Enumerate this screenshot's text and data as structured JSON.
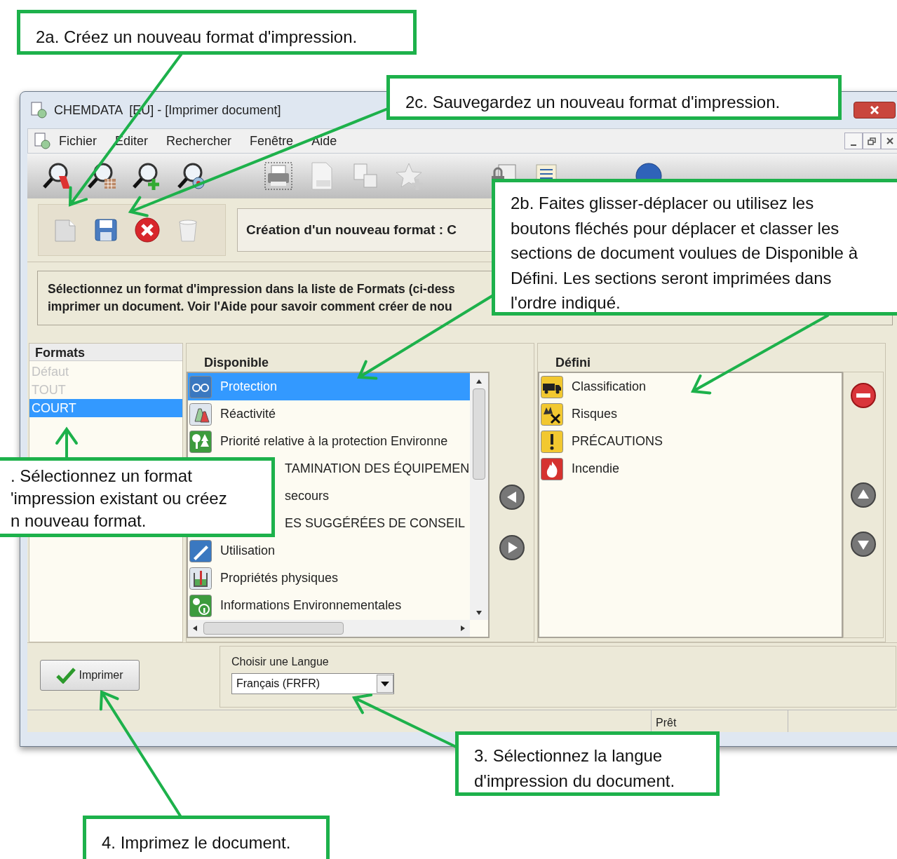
{
  "window": {
    "title": "CHEMDATA  [EU] - [Imprimer document]"
  },
  "menu": [
    "Fichier",
    "Editer",
    "Rechercher",
    "Fenêtre",
    "Aide"
  ],
  "format_heading": "Création d'un nouveau format : C",
  "info_lines": [
    "Sélectionnez un format d'impression dans la liste de Formats (ci-dess",
    "imprimer un document. Voir l'Aide pour savoir comment créer de nou"
  ],
  "formats": {
    "header": "Formats",
    "items": [
      {
        "label": "Défaut",
        "selected": false,
        "disabled": true
      },
      {
        "label": "TOUT",
        "selected": false,
        "disabled": true
      },
      {
        "label": "COURT",
        "selected": true,
        "disabled": false
      }
    ]
  },
  "available": {
    "header": "Disponible",
    "items": [
      {
        "label": "Protection",
        "kind": "glasses",
        "selected": true
      },
      {
        "label": "Réactivité",
        "kind": "flask",
        "selected": false
      },
      {
        "label": "Priorité relative à la protection Environne",
        "kind": "trees",
        "selected": false
      },
      {
        "label": "TAMINATION DES ÉQUIPEMEN",
        "selected": false
      },
      {
        "label": "secours",
        "selected": false
      },
      {
        "label": "ES SUGGÉRÉES DE CONSEIL",
        "selected": false
      },
      {
        "label": "Utilisation",
        "kind": "pen",
        "selected": false
      },
      {
        "label": "Propriétés physiques",
        "kind": "beaker",
        "selected": false
      },
      {
        "label": "Informations Environnementales",
        "kind": "info",
        "selected": false
      }
    ]
  },
  "defined": {
    "header": "Défini",
    "items": [
      {
        "label": "Classification",
        "kind": "truck",
        "selected": false
      },
      {
        "label": "Risques",
        "kind": "risk",
        "selected": false
      },
      {
        "label": "PRÉCAUTIONS",
        "kind": "warning",
        "selected": false
      },
      {
        "label": "Incendie",
        "kind": "fire",
        "selected": false
      }
    ]
  },
  "print_button": "Imprimer",
  "language": {
    "label": "Choisir une Langue",
    "value": "Français (FRFR)"
  },
  "status_bar": "Prêt",
  "callouts": [
    {
      "lines": [
        "2a. Créez un nouveau format d'impression."
      ]
    },
    {
      "lines": [
        "2c. Sauvegardez un nouveau format d'impression."
      ]
    },
    {
      "lines": [
        "2b. Faites glisser-déplacer ou utilisez les",
        "boutons fléchés pour déplacer et classer les",
        "sections de document voulues de Disponible à",
        "Défini. Les sections seront imprimées dans",
        "l'ordre indiqué."
      ]
    },
    {
      "lines": [
        ". Sélectionnez un format",
        "'impression existant ou créez",
        "n nouveau format."
      ]
    },
    {
      "lines": [
        "3. Sélectionnez la langue",
        "d'impression du document."
      ]
    },
    {
      "lines": [
        "4. Imprimez le document."
      ]
    }
  ]
}
